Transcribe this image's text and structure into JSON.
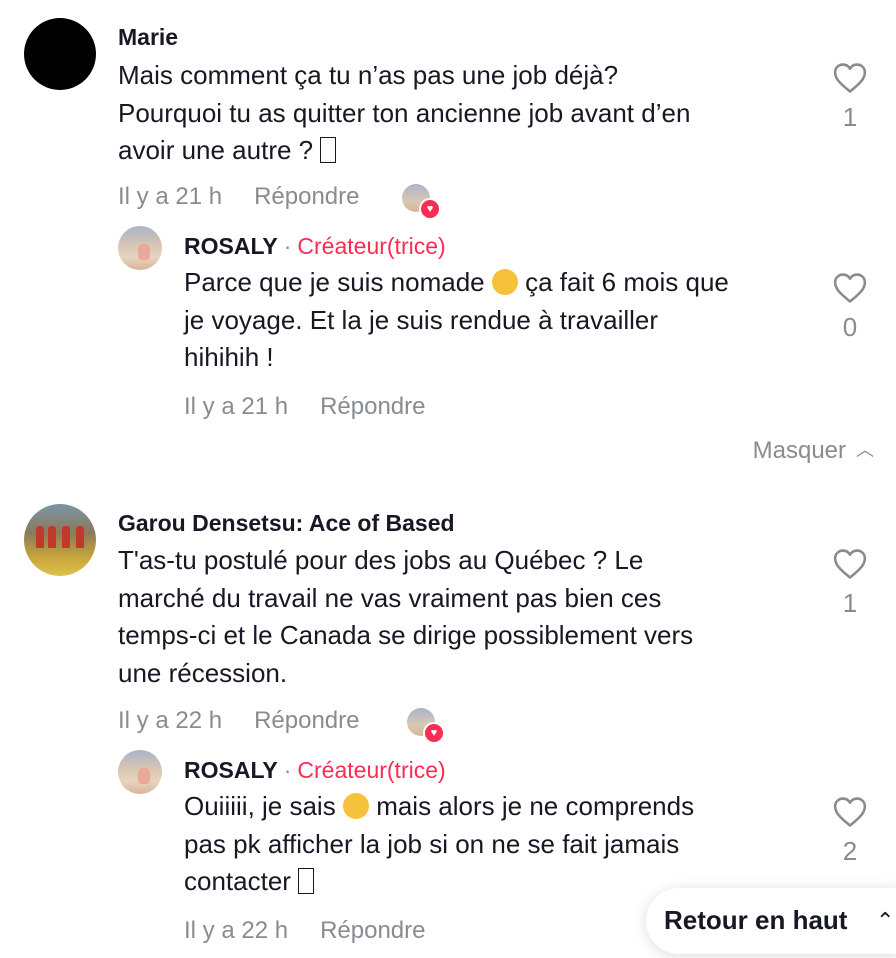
{
  "comments": [
    {
      "username": "Marie",
      "text_lines": [
        "Mais comment ça tu n’as pas une job déjà?",
        "Pourquoi tu as quitter ton ancienne job avant d’en",
        "avoir une autre ?"
      ],
      "time": "Il y a 21 h",
      "reply_label": "Répondre",
      "likes": "1",
      "reply": {
        "username": "ROSALY",
        "separator": "·",
        "badge": "Créateur(trice)",
        "text_lines": [
          "Parce que je suis nomade",
          "ça fait 6 mois que",
          "je voyage. Et la je suis rendue à travailler",
          "hihihih !"
        ],
        "time": "Il y a 21 h",
        "reply_label": "Répondre",
        "likes": "0"
      }
    },
    {
      "username": "Garou Densetsu: Ace of Based",
      "text_lines": [
        "T'as-tu postulé pour des jobs au Québec ? Le",
        "marché du travail ne vas vraiment pas bien ces",
        "temps-ci et le Canada se dirige possiblement vers",
        "une récession."
      ],
      "time": "Il y a 22 h",
      "reply_label": "Répondre",
      "likes": "1",
      "reply": {
        "username": "ROSALY",
        "separator": "·",
        "badge": "Créateur(trice)",
        "text_lines": [
          "Ouiiiii, je sais",
          "mais alors je ne comprends",
          "pas pk afficher la job si on ne se fait jamais",
          "contacter"
        ],
        "time": "Il y a 22 h",
        "reply_label": "Répondre",
        "likes": "2"
      }
    }
  ],
  "hide_label": "Masquer",
  "back_to_top_label": "Retour en haut",
  "colors": {
    "creator_badge": "#fe2c55",
    "secondary_text": "#8a8b91",
    "primary_text": "#161823"
  },
  "icons": {
    "like": "heart-outline-icon",
    "hide": "chevron-up-icon",
    "back_to_top": "double-chevron-up-icon"
  }
}
